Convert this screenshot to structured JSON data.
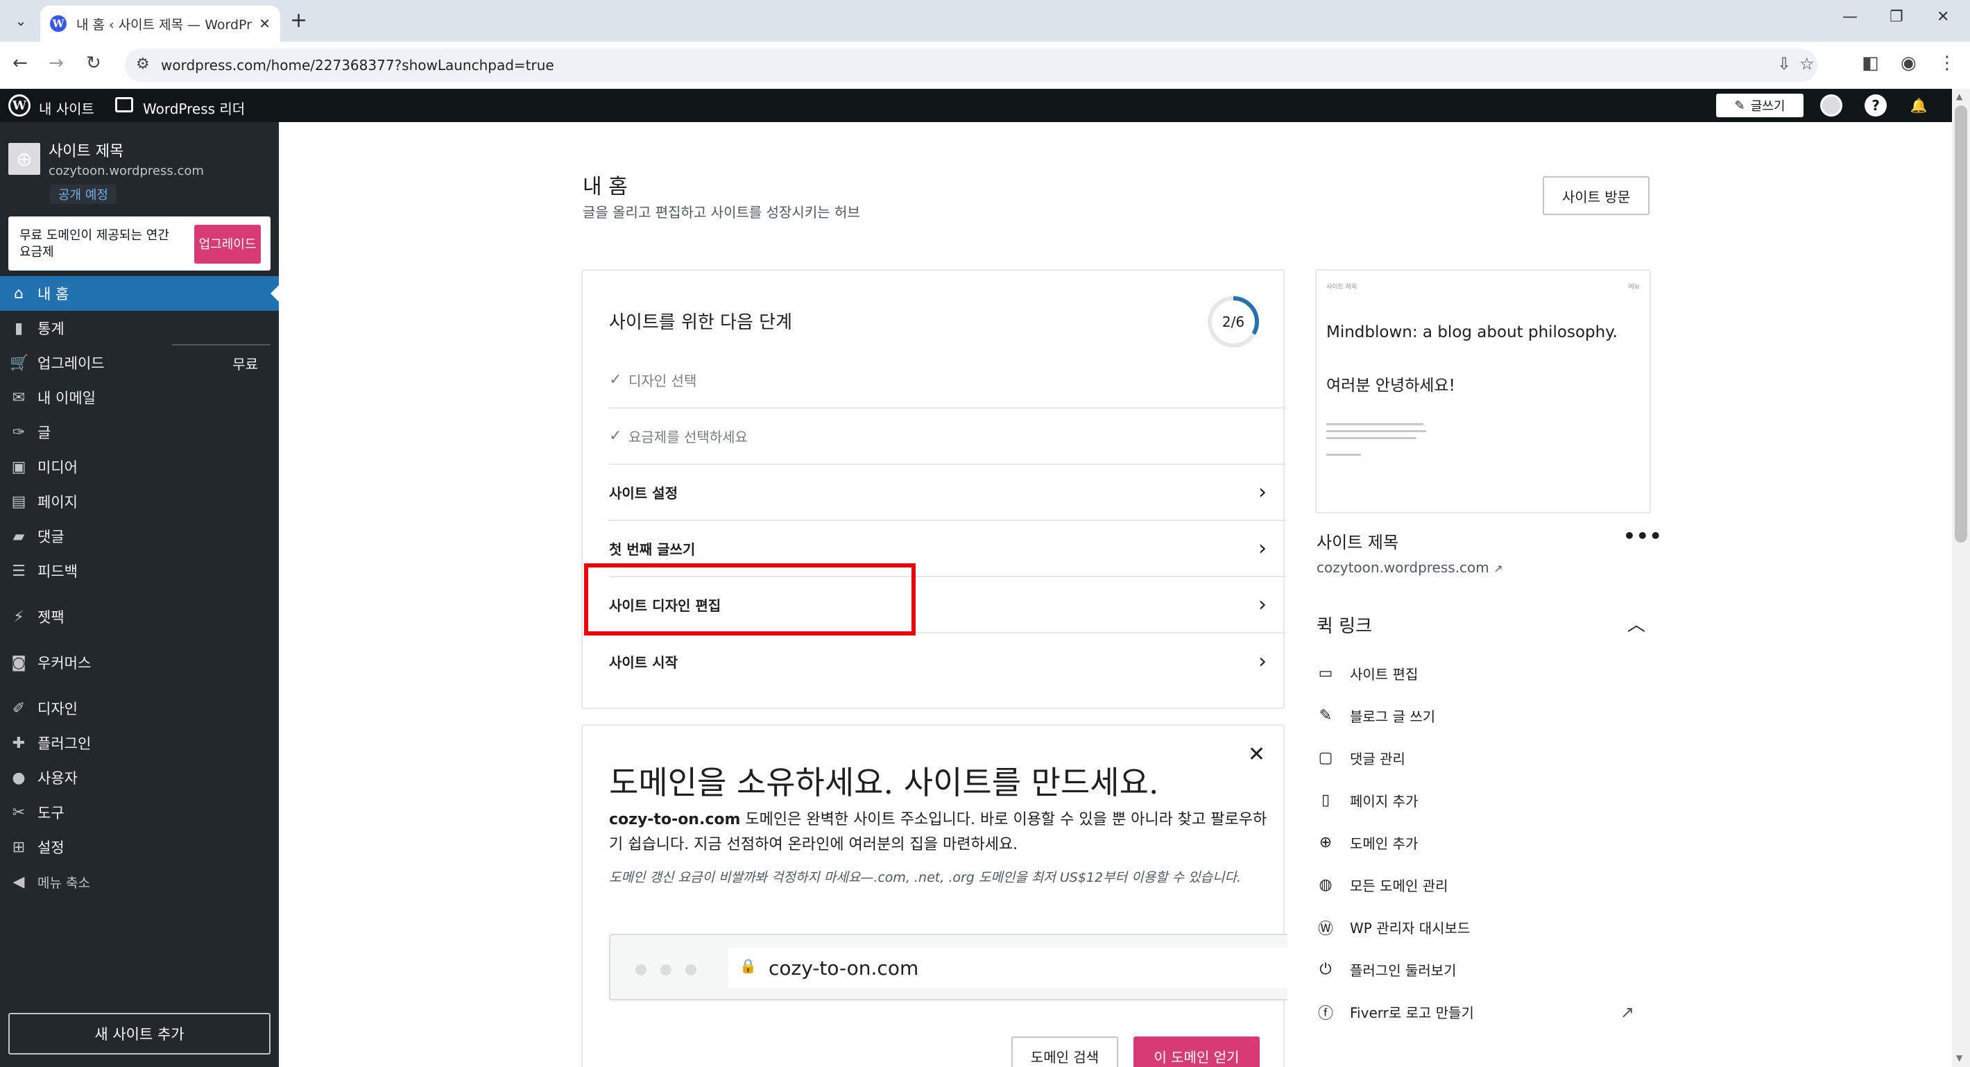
{
  "browser": {
    "tab_title": "내 홈 ‹ 사이트 제목 — WordPr",
    "url": "wordpress.com/home/227368377?showLaunchpad=true"
  },
  "adminbar": {
    "my_site": "내 사이트",
    "reader": "WordPress 리더",
    "write": "글쓰기"
  },
  "sidebar": {
    "site_title": "사이트 제목",
    "site_url": "cozytoon.wordpress.com",
    "status_badge": "공개 예정",
    "upgrade_text": "무료 도메인이 제공되는 연간 요금제",
    "upgrade_button": "업그레이드",
    "items": [
      {
        "label": "내 홈",
        "icon": "home-icon"
      },
      {
        "label": "통계",
        "icon": "stats-icon"
      },
      {
        "label": "업그레이드",
        "icon": "cart-icon",
        "right": "무료"
      },
      {
        "label": "내 이메일",
        "icon": "mail-icon"
      },
      {
        "label": "글",
        "icon": "pin-icon"
      },
      {
        "label": "미디어",
        "icon": "media-icon"
      },
      {
        "label": "페이지",
        "icon": "page-icon"
      },
      {
        "label": "댓글",
        "icon": "comment-icon"
      },
      {
        "label": "피드백",
        "icon": "feedback-icon"
      },
      {
        "label": "젯팩",
        "icon": "jetpack-icon"
      },
      {
        "label": "우커머스",
        "icon": "woo-icon"
      },
      {
        "label": "디자인",
        "icon": "brush-icon"
      },
      {
        "label": "플러그인",
        "icon": "plugin-icon"
      },
      {
        "label": "사용자",
        "icon": "user-icon"
      },
      {
        "label": "도구",
        "icon": "wrench-icon"
      },
      {
        "label": "설정",
        "icon": "settings-icon"
      },
      {
        "label": "메뉴 축소",
        "icon": "collapse-icon"
      }
    ],
    "add_site": "새 사이트 추가"
  },
  "main": {
    "title": "내 홈",
    "subtitle": "글을 올리고 편집하고 사이트를 성장시키는 허브",
    "visit_site": "사이트 방문"
  },
  "steps": {
    "heading": "사이트를 위한 다음 단계",
    "progress_label": "2/6",
    "progress_done": 2,
    "progress_total": 6,
    "items": [
      {
        "label": "디자인 선택",
        "done": true
      },
      {
        "label": "요금제를 선택하세요",
        "done": true
      },
      {
        "label": "사이트 설정",
        "done": false
      },
      {
        "label": "첫 번째 글쓰기",
        "done": false
      },
      {
        "label": "사이트 디자인 편집",
        "done": false
      },
      {
        "label": "사이트 시작",
        "done": false
      }
    ]
  },
  "domain_card": {
    "title": "도메인을 소유하세요. 사이트를 만드세요.",
    "domain": "cozy-to-on.com",
    "desc": " 도메인은 완벽한 사이트 주소입니다. 바로 이용할 수 있을 뿐 아니라 찾고 팔로우하기 쉽습니다. 지금 선점하여 온라인에 여러분의 집을 마련하세요.",
    "note": "도메인 갱신 요금이 비쌀까봐 걱정하지 마세요—.com, .net, .org 도메인을 최저 US$12부터 이용할 수 있습니다.",
    "search_button": "도메인 검색",
    "get_button": "이 도메인 얻기"
  },
  "preview": {
    "small_left": "사이트 제목",
    "small_right": "메뉴",
    "tagline": "Mindblown: a blog about philosophy.",
    "hello": "여러분 안녕하세요!"
  },
  "site_info": {
    "name": "사이트 제목",
    "url": "cozytoon.wordpress.com"
  },
  "quick_links": {
    "title": "퀵 링크",
    "items": [
      {
        "label": "사이트 편집",
        "icon": "laptop-icon"
      },
      {
        "label": "블로그 글 쓰기",
        "icon": "pencil-icon"
      },
      {
        "label": "댓글 관리",
        "icon": "comment-icon"
      },
      {
        "label": "페이지 추가",
        "icon": "page-icon"
      },
      {
        "label": "도메인 추가",
        "icon": "plus-circle-icon"
      },
      {
        "label": "모든 도메인 관리",
        "icon": "globe-icon"
      },
      {
        "label": "WP 관리자 대시보드",
        "icon": "wordpress-icon"
      },
      {
        "label": "플러그인 둘러보기",
        "icon": "plug-icon"
      },
      {
        "label": "Fiverr로 로고 만들기",
        "icon": "fiverr-icon",
        "external": true
      }
    ]
  }
}
